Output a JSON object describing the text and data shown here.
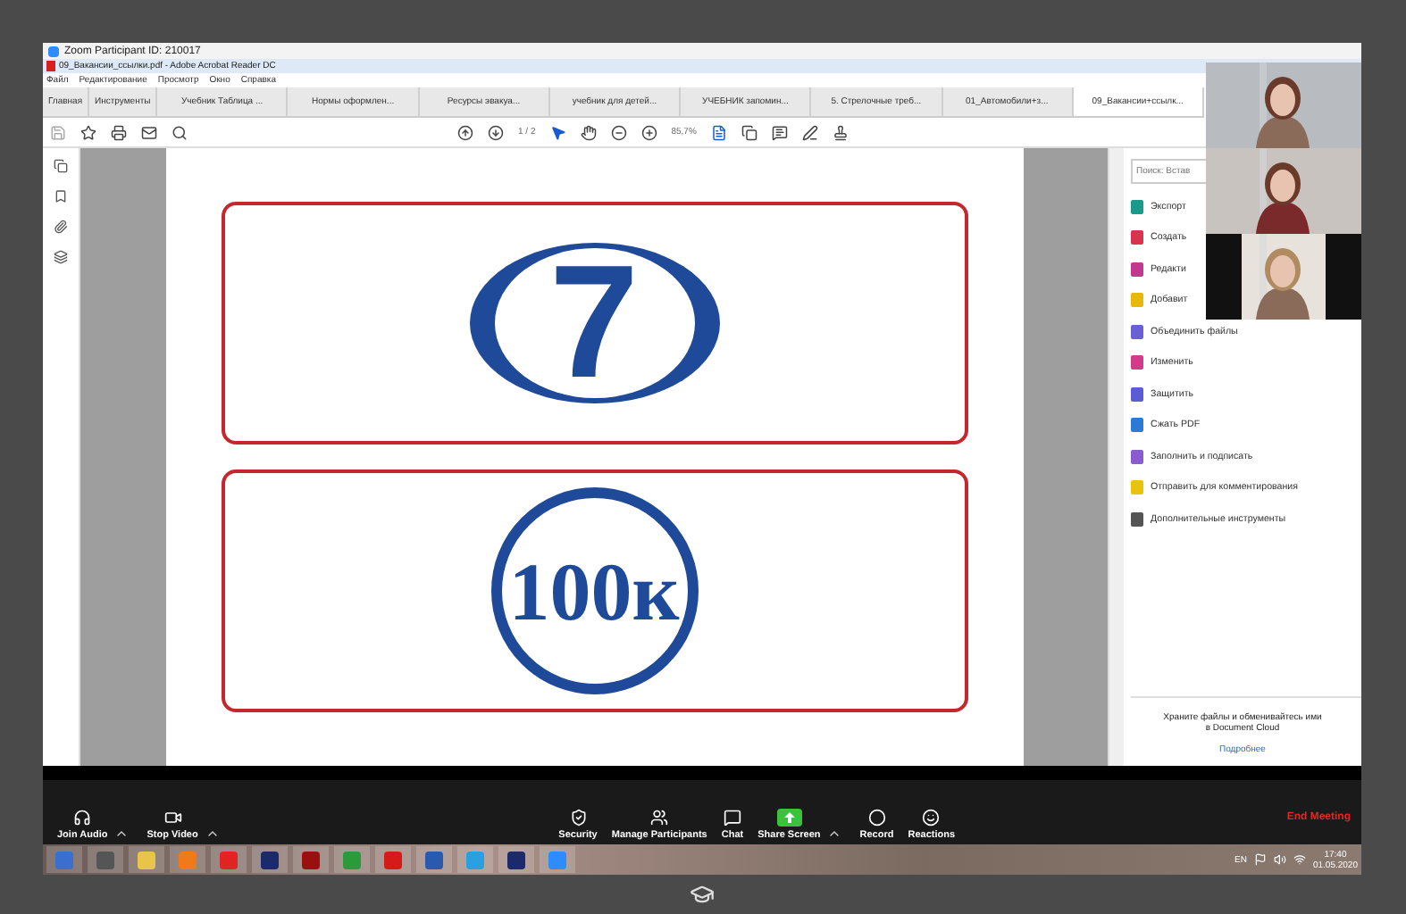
{
  "zoom_window": {
    "title": "Zoom Participant ID: 210017"
  },
  "acrobat": {
    "title": "09_Вакансии_ссылки.pdf - Adobe Acrobat Reader DC",
    "menu": [
      "Файл",
      "Редактирование",
      "Просмотр",
      "Окно",
      "Справка"
    ],
    "home_tabs": [
      {
        "label": "Главная",
        "selected": false
      },
      {
        "label": "Инструменты",
        "selected": false
      }
    ],
    "doc_tabs": [
      {
        "label": "Учебник Таблица ...",
        "selected": false
      },
      {
        "label": "Нормы оформлен...",
        "selected": false
      },
      {
        "label": "Ресурсы эвакуа...",
        "selected": false
      },
      {
        "label": "учебник для детей...",
        "selected": false
      },
      {
        "label": "УЧЕБНИК запомин...",
        "selected": false
      },
      {
        "label": "5. Стрелочные треб...",
        "selected": false
      },
      {
        "label": "01_Автомобили+з...",
        "selected": false
      },
      {
        "label": "09_Вакансии+ссылк...",
        "selected": true
      }
    ],
    "page_field": "1 / 2",
    "zoom_level": "85,7%",
    "signs": [
      {
        "kind": "ellipse",
        "text": "7"
      },
      {
        "kind": "circle",
        "text": "100к"
      }
    ],
    "search": {
      "placeholder": "Поиск: Встав"
    },
    "tools": [
      {
        "label": "Экспорт",
        "color": "#1a9a8a"
      },
      {
        "label": "Создать",
        "color": "#d9344f"
      },
      {
        "label": "Редакти",
        "color": "#c2388f"
      },
      {
        "label": "Добавит",
        "color": "#e8b80c"
      },
      {
        "label": "Объединить файлы",
        "color": "#6b5fd6"
      },
      {
        "label": "Изменить",
        "color": "#d23a8a"
      },
      {
        "label": "Защитить",
        "color": "#5b5bd6"
      },
      {
        "label": "Сжать PDF",
        "color": "#2a7ad6"
      },
      {
        "label": "Заполнить и подписать",
        "color": "#8a5cd0"
      },
      {
        "label": "Отправить для комментирования",
        "color": "#e8c20c"
      },
      {
        "label": "Дополнительные инструменты",
        "color": "#555555"
      }
    ],
    "cloud_note": "Храните файлы и обменивайтесь ими в Document Cloud",
    "cloud_link": "Подробнее"
  },
  "meeting_controls": [
    {
      "kind": "audio",
      "label": "Join Audio",
      "caret": true
    },
    {
      "kind": "video",
      "label": "Stop Video",
      "caret": true
    },
    {
      "kind": "security",
      "label": "Security"
    },
    {
      "kind": "participants",
      "label": "Manage Participants"
    },
    {
      "kind": "chat",
      "label": "Chat"
    },
    {
      "kind": "share",
      "label": "Share Screen",
      "caret": true
    },
    {
      "kind": "record",
      "label": "Record"
    },
    {
      "kind": "reactions",
      "label": "Reactions"
    }
  ],
  "end_meeting": "End Meeting",
  "taskbar": {
    "apps": [
      {
        "color": "#3a6fd0"
      },
      {
        "color": "#555555"
      },
      {
        "color": "#e8c44a"
      },
      {
        "color": "#f07a1a"
      },
      {
        "color": "#e02424"
      },
      {
        "color": "#1a2a6a"
      },
      {
        "color": "#9a1010"
      },
      {
        "color": "#2a9a3a"
      },
      {
        "color": "#d61a1a"
      },
      {
        "color": "#2a5ab0"
      },
      {
        "color": "#2aa0e0"
      },
      {
        "color": "#1a2a6a"
      },
      {
        "color": "#2d8cff"
      }
    ],
    "language": "EN",
    "time": "17:40",
    "date": "01.05.2020"
  }
}
